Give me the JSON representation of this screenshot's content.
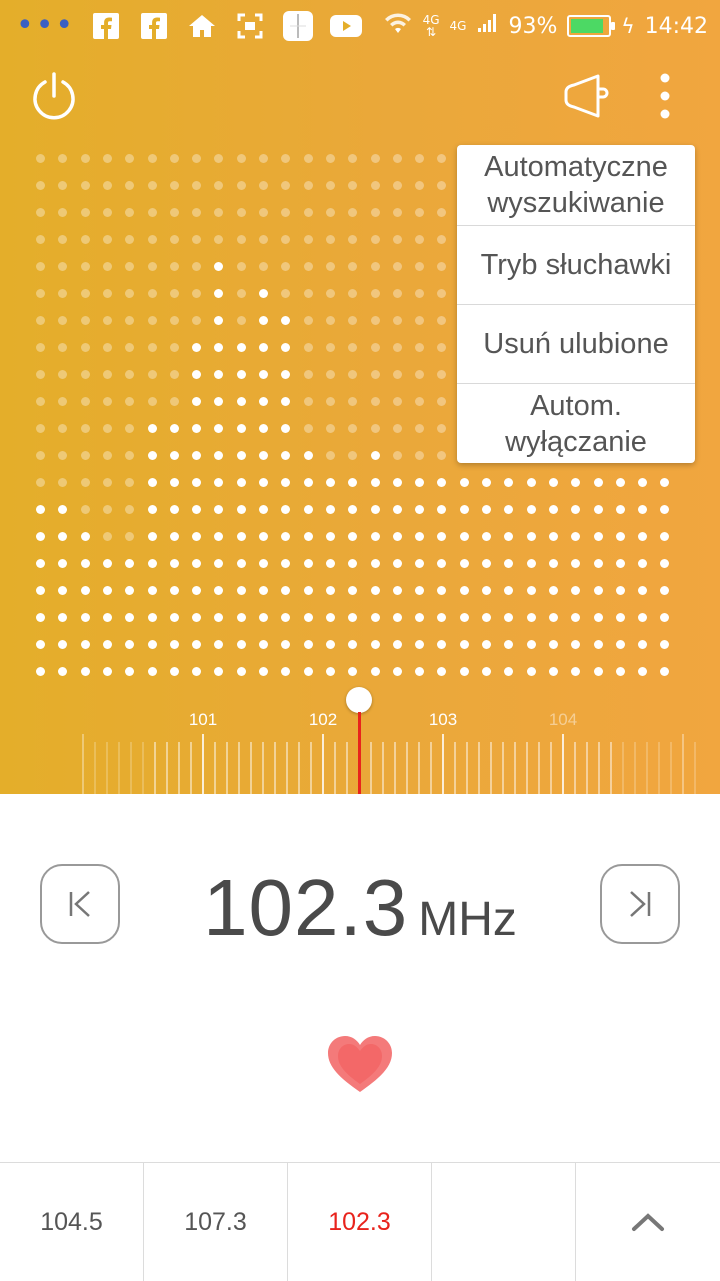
{
  "status_bar": {
    "left_icons": [
      "notification-dots-icon",
      "facebook-icon",
      "facebook-icon",
      "home-icon",
      "screenshot-icon",
      "radio-app-icon",
      "youtube-icon"
    ],
    "network_label_1": "4G",
    "network_label_2": "4G",
    "battery_percent": "93%",
    "battery_level": 0.93,
    "time": "14:42",
    "battery_color": "#4cd964"
  },
  "toolbar": {
    "power_icon": "power-icon",
    "speaker_icon": "speaker-icon",
    "more_icon": "more-vertical-icon"
  },
  "menu": {
    "items": [
      {
        "line1": "Automatyczne",
        "line2": "wyszukiwanie"
      },
      {
        "line1": "Tryb słuchawki",
        "line2": ""
      },
      {
        "line1": "Usuń ulubione",
        "line2": ""
      },
      {
        "line1": "Autom.",
        "line2": "wyłączanie"
      }
    ]
  },
  "scale": {
    "labels": [
      "101",
      "102",
      "103",
      "104"
    ],
    "needle_value": 102.3,
    "needle_color": "#e8231c"
  },
  "tuner": {
    "frequency": "102.3",
    "unit": "MHz",
    "prev_icon": "skip-previous-icon",
    "next_icon": "skip-next-icon",
    "favorite_icon": "heart-icon",
    "favorite_color": "#f06a6a"
  },
  "presets": {
    "items": [
      "104.5",
      "107.3",
      "102.3",
      ""
    ],
    "active_index": 2,
    "expand_icon": "chevron-up-icon"
  },
  "colors": {
    "accent": "#e8231c",
    "background_gradient_start": "#e4ae2a",
    "background_gradient_end": "#f1a63f"
  }
}
